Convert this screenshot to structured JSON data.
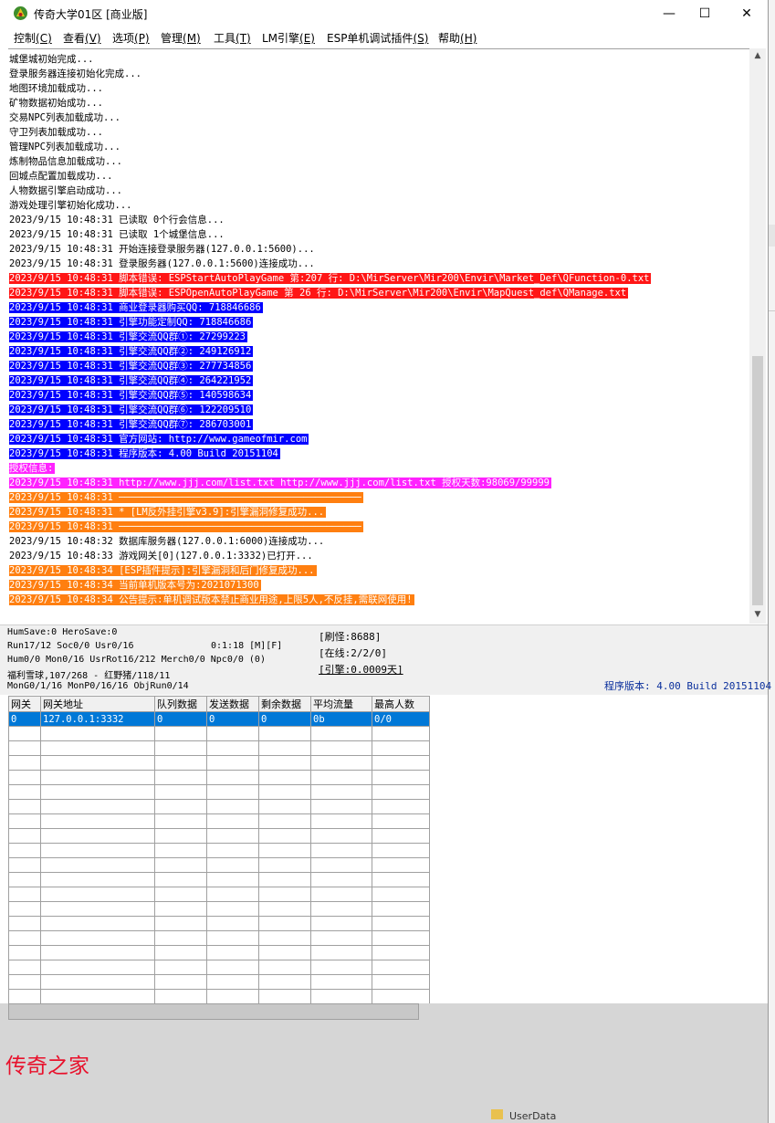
{
  "window": {
    "title": "传奇大学01区 [商业版]",
    "controls": {
      "minimize": "—",
      "maximize": "☐",
      "close": "✕"
    }
  },
  "menu": [
    {
      "label": "控制",
      "key": "(C)"
    },
    {
      "label": "查看",
      "key": "(V)"
    },
    {
      "label": "选项",
      "key": "(P)"
    },
    {
      "label": "管理",
      "key": "(M)"
    },
    {
      "label": "工具",
      "key": "(T)"
    },
    {
      "label": "LM引擎",
      "key": "(E)"
    },
    {
      "label": "ESP单机调试插件",
      "key": "(S)"
    },
    {
      "label": "帮助",
      "key": "(H)"
    }
  ],
  "log": [
    {
      "text": "城堡城初始完成...",
      "style": "normal"
    },
    {
      "text": "登录服务器连接初始化完成...",
      "style": "normal"
    },
    {
      "text": "地图环境加载成功...",
      "style": "normal"
    },
    {
      "text": "矿物数据初始成功...",
      "style": "normal"
    },
    {
      "text": "交易NPC列表加载成功...",
      "style": "normal"
    },
    {
      "text": "守卫列表加载成功...",
      "style": "normal"
    },
    {
      "text": "管理NPC列表加载成功...",
      "style": "normal"
    },
    {
      "text": "炼制物品信息加载成功...",
      "style": "normal"
    },
    {
      "text": "回城点配置加载成功...",
      "style": "normal"
    },
    {
      "text": "人物数据引擎启动成功...",
      "style": "normal"
    },
    {
      "text": "游戏处理引擎初始化成功...",
      "style": "normal"
    },
    {
      "text": "2023/9/15 10:48:31 已读取 0个行会信息...",
      "style": "normal"
    },
    {
      "text": "2023/9/15 10:48:31 已读取 1个城堡信息...",
      "style": "normal"
    },
    {
      "text": "2023/9/15 10:48:31 开始连接登录服务器(127.0.0.1:5600)...",
      "style": "normal"
    },
    {
      "text": "2023/9/15 10:48:31 登录服务器(127.0.0.1:5600)连接成功...",
      "style": "normal"
    },
    {
      "text": "2023/9/15 10:48:31 脚本错误: ESPStartAutoPlayGame 第:207 行: D:\\MirServer\\Mir200\\Envir\\Market_Def\\QFunction-0.txt",
      "style": "red"
    },
    {
      "text": "2023/9/15 10:48:31 脚本错误: ESPOpenAutoPlayGame 第 26 行: D:\\MirServer\\Mir200\\Envir\\MapQuest_def\\QManage.txt",
      "style": "red"
    },
    {
      "text": "2023/9/15 10:48:31 商业登录器购买QQ: 718846686",
      "style": "blue"
    },
    {
      "text": "2023/9/15 10:48:31 引擎功能定制QQ: 718846686",
      "style": "blue"
    },
    {
      "text": "2023/9/15 10:48:31 引擎交流QQ群①: 27299223",
      "style": "blue"
    },
    {
      "text": "2023/9/15 10:48:31 引擎交流QQ群②: 249126912",
      "style": "blue"
    },
    {
      "text": "2023/9/15 10:48:31 引擎交流QQ群③: 277734856",
      "style": "blue"
    },
    {
      "text": "2023/9/15 10:48:31 引擎交流QQ群④: 264221952",
      "style": "blue"
    },
    {
      "text": "2023/9/15 10:48:31 引擎交流QQ群⑤: 140598634",
      "style": "blue"
    },
    {
      "text": "2023/9/15 10:48:31 引擎交流QQ群⑥: 122209510",
      "style": "blue"
    },
    {
      "text": "2023/9/15 10:48:31 引擎交流QQ群⑦: 286703001",
      "style": "blue"
    },
    {
      "text": "2023/9/15 10:48:31 官方网站: http://www.gameofmir.com",
      "style": "blue"
    },
    {
      "text": "2023/9/15 10:48:31 程序版本: 4.00 Build 20151104",
      "style": "blue"
    },
    {
      "text": "授权信息:",
      "style": "mag"
    },
    {
      "text": "2023/9/15 10:48:31 http://www.jjj.com/list.txt http://www.jjj.com/list.txt 授权天数:98069/99999",
      "style": "mag"
    },
    {
      "text": "2023/9/15 10:48:31 ──────────────────────────────────────────",
      "style": "org"
    },
    {
      "text": "2023/9/15 10:48:31 * [LM反外挂引擎v3.9]:引擎漏洞修复成功...",
      "style": "org"
    },
    {
      "text": "2023/9/15 10:48:31 ──────────────────────────────────────────",
      "style": "org"
    },
    {
      "text": "2023/9/15 10:48:32 数据库服务器(127.0.0.1:6000)连接成功...",
      "style": "normal"
    },
    {
      "text": "2023/9/15 10:48:33 游戏网关[0](127.0.0.1:3332)已打开...",
      "style": "normal"
    },
    {
      "text": "2023/9/15 10:48:34 [ESP插件提示]:引擎漏洞和后门修复成功...",
      "style": "org"
    },
    {
      "text": "2023/9/15 10:48:34 当前单机版本号为:2021071300",
      "style": "org"
    },
    {
      "text": "2023/9/15 10:48:34 公告提示:单机调试版本禁止商业用途,上限5人,不反挂,需联网使用!",
      "style": "org"
    }
  ],
  "status": {
    "line1": "HumSave:0 HeroSave:0",
    "line2": "Run17/12 Soc0/0 Usr0/16",
    "time": "0:1:18 [M][F]",
    "line3": "Hum0/0 Mon0/16 UsrRot16/212 Merch0/0 Npc0/0 (0)",
    "line4": "福利雪球,107/268 - 红野猪/118/11",
    "line5": "MonG0/1/16 MonP0/16/16 ObjRun0/14",
    "refresh": "[刷怪:8688]",
    "online": "[在线:2/2/0]",
    "engine": "[引擎:0.0009天]",
    "version": "程序版本: 4.00 Build 20151104"
  },
  "gateway_table": {
    "headers": [
      "网关",
      "网关地址",
      "队列数据",
      "发送数据",
      "剩余数据",
      "平均流量",
      "最高人数"
    ],
    "rows": [
      [
        "0",
        "127.0.0.1:3332",
        "0",
        "0",
        "0",
        "0b",
        "0/0"
      ]
    ],
    "empty_rows": 19
  },
  "watermark": "传奇之家",
  "desktop_item": "UserData"
}
